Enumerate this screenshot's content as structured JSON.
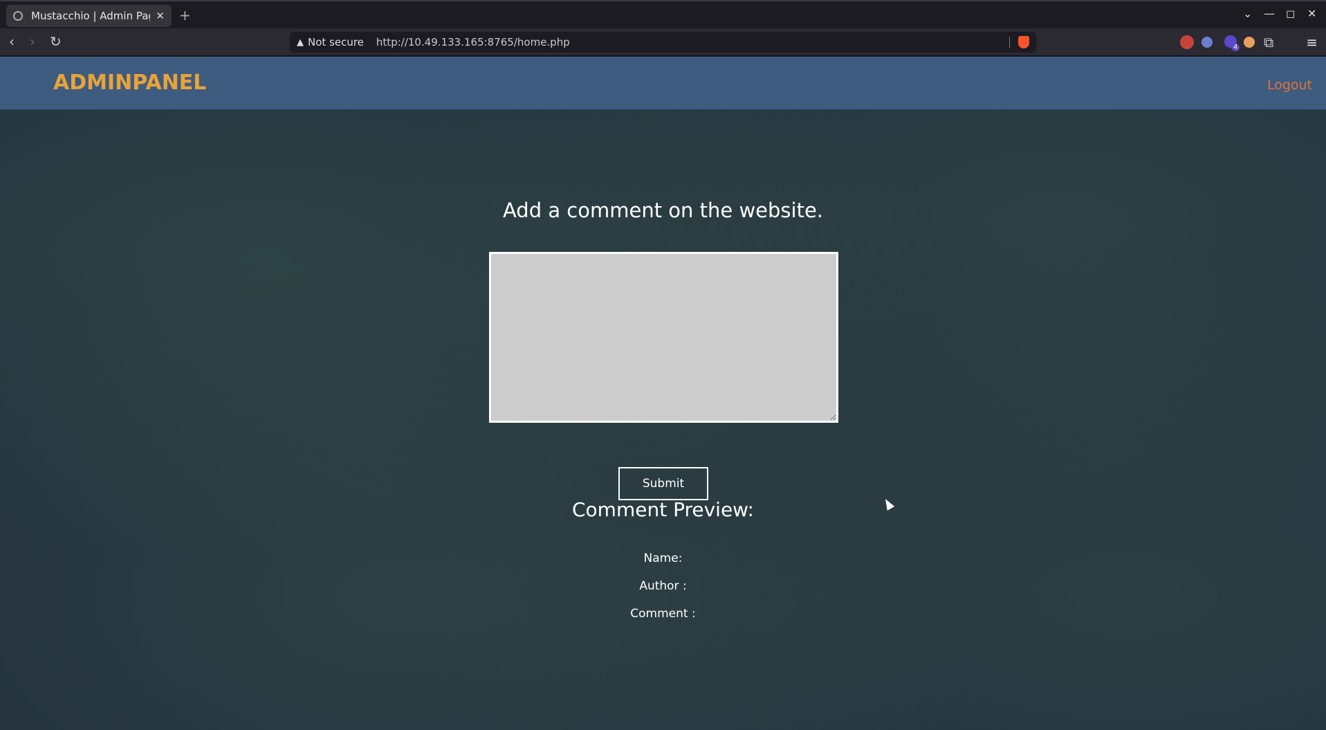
{
  "browser": {
    "tab_title": "Mustacchio | Admin Pag",
    "tab_close": "✕",
    "new_tab": "+",
    "not_secure": "Not secure",
    "url": "http://10.49.133.165:8765/home.php",
    "extension_badge": "4",
    "window_controls": {
      "minimize": "—",
      "maximize": "◻",
      "close": "✕"
    }
  },
  "navbar": {
    "brand": "ADMINPANEL",
    "logout": "Logout"
  },
  "main": {
    "heading": "Add a comment on the website.",
    "textarea_value": "",
    "submit_label": "Submit",
    "preview_title": "Comment Preview:",
    "fields": {
      "name": "Name:",
      "author": "Author :",
      "comment": "Comment :"
    }
  },
  "colors": {
    "brand": "#e8a33a",
    "logout": "#e0723c",
    "navbar": "#3e5c80",
    "background": "#24313f"
  }
}
